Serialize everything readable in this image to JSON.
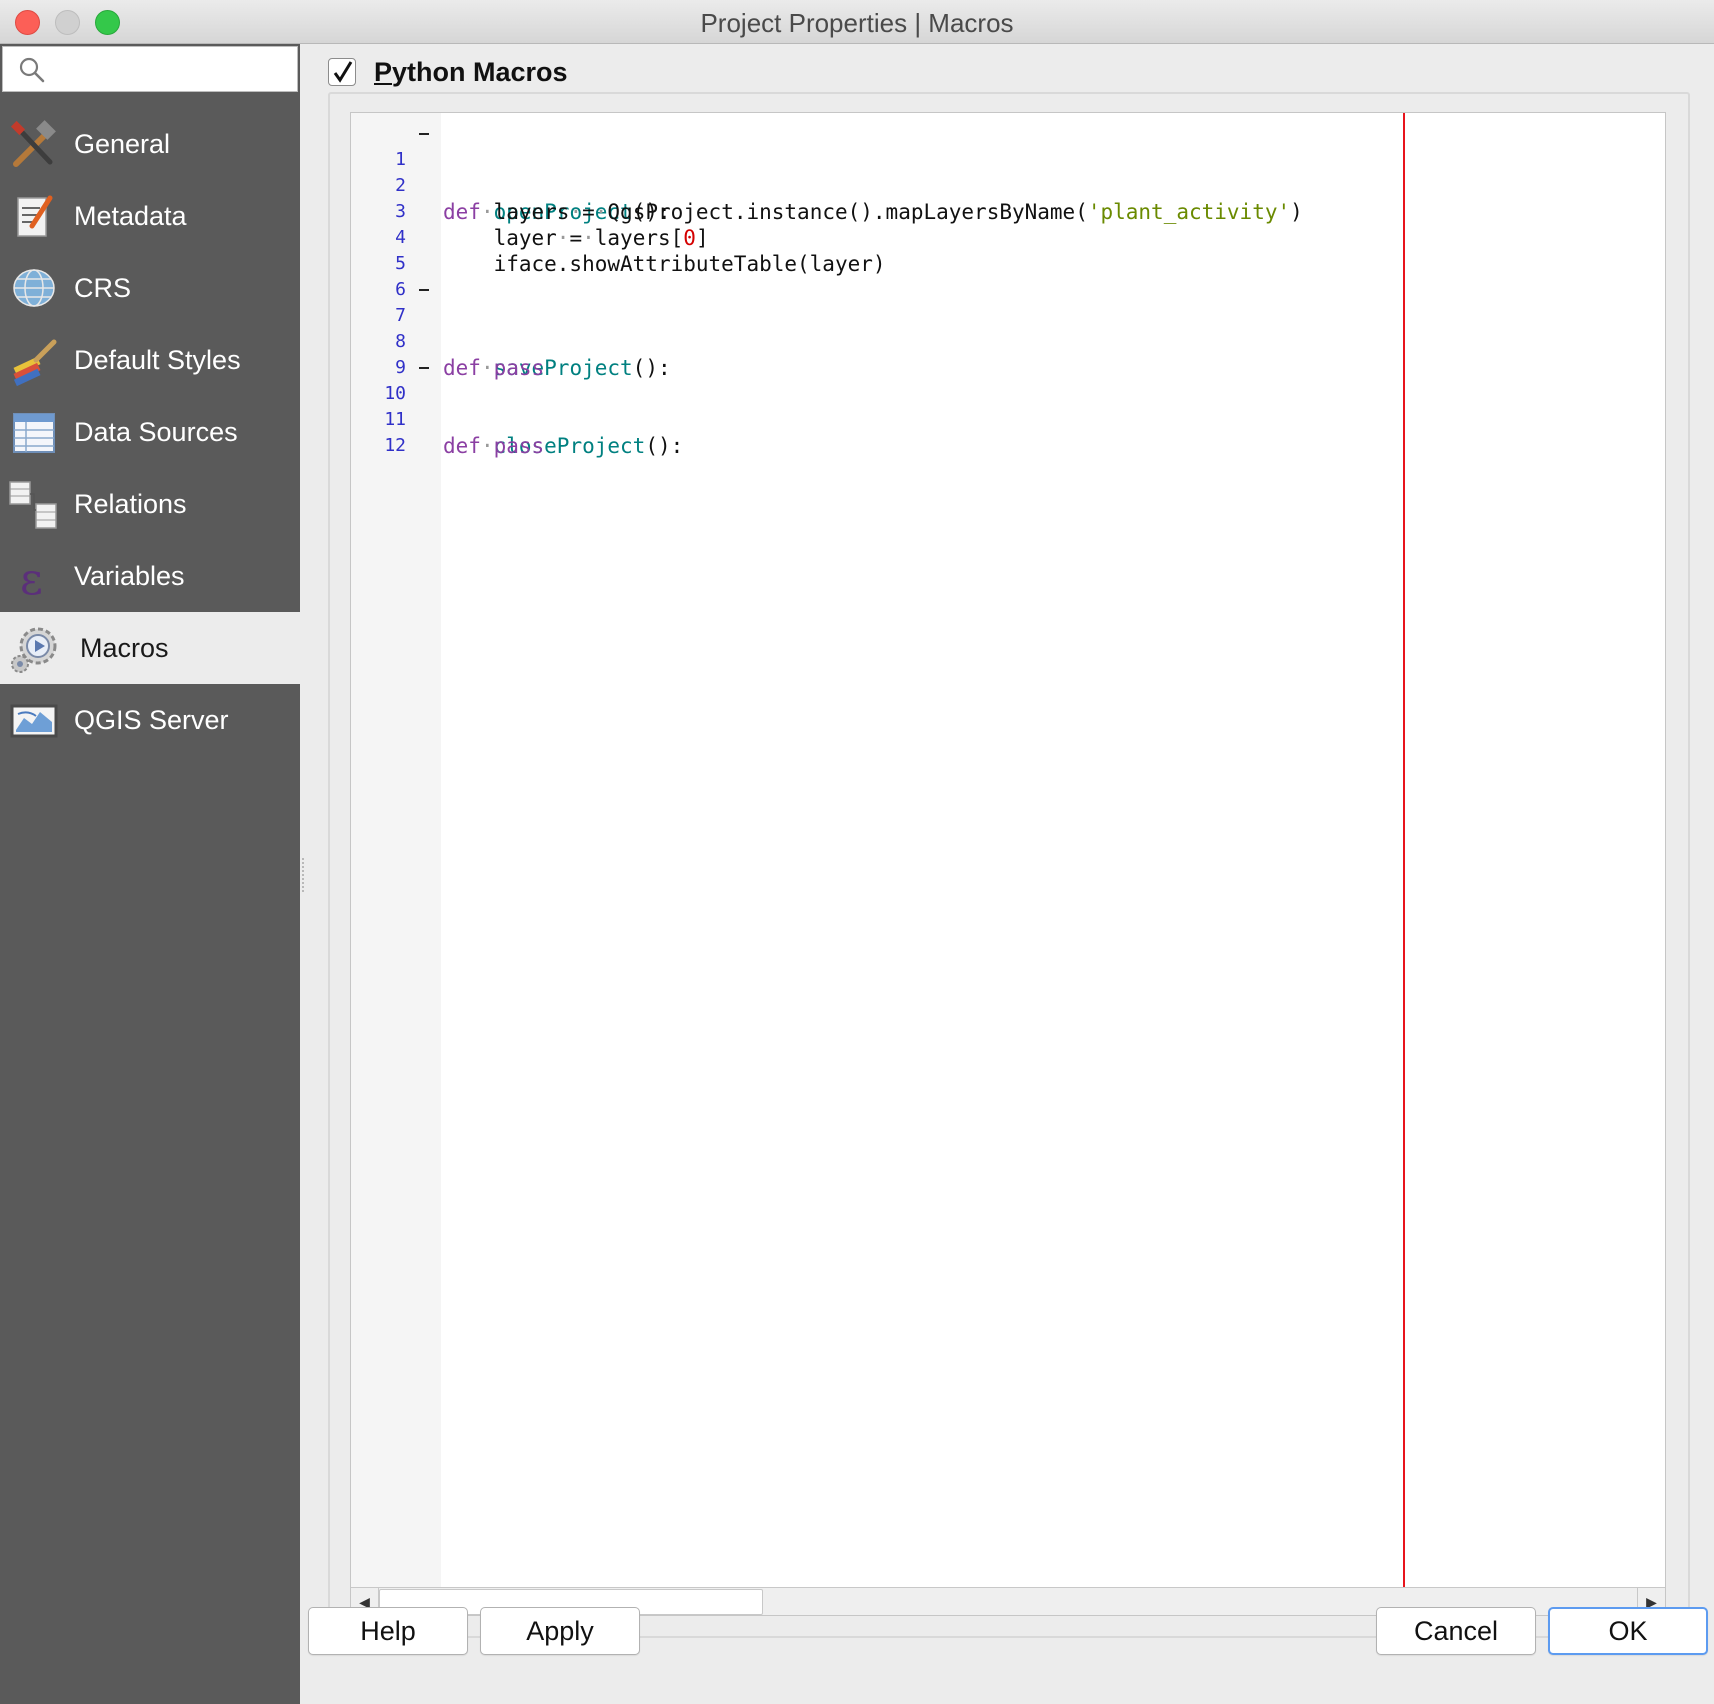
{
  "window": {
    "title": "Project Properties | Macros"
  },
  "search": {
    "placeholder": ""
  },
  "sidebar": {
    "items": [
      {
        "label": "General",
        "icon": "hammer-icon"
      },
      {
        "label": "Metadata",
        "icon": "document-pen-icon"
      },
      {
        "label": "CRS",
        "icon": "globe-icon"
      },
      {
        "label": "Default Styles",
        "icon": "paintbrush-icon"
      },
      {
        "label": "Data Sources",
        "icon": "table-icon"
      },
      {
        "label": "Relations",
        "icon": "relations-icon"
      },
      {
        "label": "Variables",
        "icon": "epsilon-icon"
      },
      {
        "label": "Macros",
        "icon": "gear-play-icon",
        "active": true
      },
      {
        "label": "QGIS Server",
        "icon": "map-server-icon"
      }
    ]
  },
  "macros": {
    "group_title_rest": "ython Macros",
    "group_title_mnemonic": "P",
    "enabled": true
  },
  "editor": {
    "line_numbers": [
      "1",
      "2",
      "3",
      "4",
      "5",
      "6",
      "7",
      "8",
      "9",
      "10",
      "11",
      "12"
    ],
    "tokens": {
      "def": "def",
      "openProject": "openProject",
      "saveProject": "saveProject",
      "closeProject": "closeProject",
      "parens_colon": "():",
      "layers": "layers",
      "assign": "=",
      "qgs_call": "QgsProject.instance().mapLayersByName(",
      "layer_name_str": "'plant_activity'",
      "close_paren": ")",
      "layer": "layer",
      "layers_open": "layers[",
      "zero": "0",
      "close_bracket": "]",
      "iface_call": "iface.showAttributeTable(layer)",
      "pass": "pass",
      "space_dot": "·"
    }
  },
  "buttons": {
    "help": "Help",
    "apply": "Apply",
    "cancel": "Cancel",
    "ok": "OK"
  },
  "colors": {
    "keyword": "#8b3fa3",
    "function_name": "#008080",
    "string": "#6a8a00",
    "number": "#d40000",
    "edge_marker": "#e8141c",
    "sidebar_bg": "#5a5a5a",
    "ok_focus": "#5d9bf0"
  }
}
